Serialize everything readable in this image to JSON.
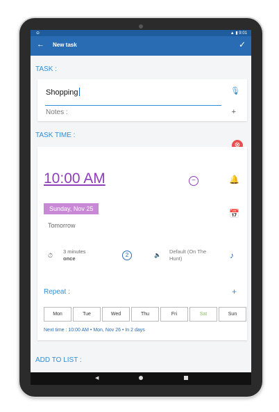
{
  "status_bar": {
    "left": "⊝",
    "right": "▲ ▮ 9:01"
  },
  "app_bar": {
    "back": "←",
    "title": "New task",
    "confirm": "✓"
  },
  "task": {
    "section_label": "TASK :",
    "name_value": "Shopping",
    "notes_placeholder": "Notes :",
    "add_note": "+"
  },
  "task_time": {
    "section_label": "TASK TIME :",
    "time": "10:00 AM",
    "date": "Sunday, Nov 25",
    "relative_day": "Tomorrow",
    "duration_line1": "3 minutes",
    "duration_line2": "once",
    "alarm_badge": "2",
    "sound_line1": "Default (On The",
    "sound_line2": "Hunt)",
    "repeat_label": "Repeat :",
    "repeat_add": "+",
    "days": [
      "Mon",
      "Tue",
      "Wed",
      "Thu",
      "Fri",
      "Sat",
      "Sun"
    ],
    "next_time": "Next time : 10:00 AM • Mon, Nov 26 • In 2 days"
  },
  "add_to_list": {
    "section_label": "ADD TO LIST :"
  },
  "nav": {
    "back": "◀"
  },
  "colors": {
    "primary": "#2a6cb3",
    "accent_purple": "#8e3fb8",
    "date_chip": "#c888d6",
    "clear": "#e94e4e"
  }
}
